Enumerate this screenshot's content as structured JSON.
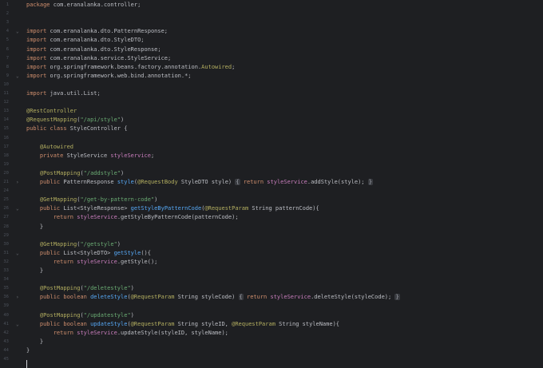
{
  "editor": {
    "lines": [
      {
        "n": "1",
        "fold": "",
        "tokens": [
          {
            "t": "k",
            "v": "package"
          },
          {
            "t": "p",
            "v": " com.eranalanka.controller;"
          }
        ]
      },
      {
        "n": "2",
        "fold": "",
        "tokens": []
      },
      {
        "n": "3",
        "fold": "",
        "tokens": []
      },
      {
        "n": "4",
        "fold": "⌄",
        "tokens": [
          {
            "t": "k",
            "v": "import"
          },
          {
            "t": "p",
            "v": " com.eranalanka.dto.PatternResponse;"
          }
        ]
      },
      {
        "n": "5",
        "fold": "",
        "tokens": [
          {
            "t": "k",
            "v": "import"
          },
          {
            "t": "p",
            "v": " com.eranalanka.dto.StyleDTO;"
          }
        ]
      },
      {
        "n": "6",
        "fold": "",
        "tokens": [
          {
            "t": "k",
            "v": "import"
          },
          {
            "t": "p",
            "v": " com.eranalanka.dto.StyleResponse;"
          }
        ]
      },
      {
        "n": "7",
        "fold": "",
        "tokens": [
          {
            "t": "k",
            "v": "import"
          },
          {
            "t": "p",
            "v": " com.eranalanka.service.StyleService;"
          }
        ]
      },
      {
        "n": "8",
        "fold": "",
        "tokens": [
          {
            "t": "k",
            "v": "import"
          },
          {
            "t": "p",
            "v": " org.springframework.beans.factory.annotation."
          },
          {
            "t": "a",
            "v": "Autowired"
          },
          {
            "t": "p",
            "v": ";"
          }
        ]
      },
      {
        "n": "9",
        "fold": "⌄",
        "tokens": [
          {
            "t": "k",
            "v": "import"
          },
          {
            "t": "p",
            "v": " org.springframework.web.bind.annotation.*;"
          }
        ]
      },
      {
        "n": "10",
        "fold": "",
        "tokens": []
      },
      {
        "n": "11",
        "fold": "",
        "tokens": [
          {
            "t": "k",
            "v": "import"
          },
          {
            "t": "p",
            "v": " java.util.List;"
          }
        ]
      },
      {
        "n": "12",
        "fold": "",
        "tokens": []
      },
      {
        "n": "13",
        "fold": "",
        "tokens": [
          {
            "t": "a",
            "v": "@RestController"
          }
        ]
      },
      {
        "n": "14",
        "fold": "",
        "tokens": [
          {
            "t": "a",
            "v": "@RequestMapping"
          },
          {
            "t": "p",
            "v": "("
          },
          {
            "t": "s",
            "v": "\"/api/style\""
          },
          {
            "t": "p",
            "v": ")"
          }
        ]
      },
      {
        "n": "15",
        "fold": "",
        "tokens": [
          {
            "t": "k",
            "v": "public class"
          },
          {
            "t": "p",
            "v": " StyleController {"
          }
        ]
      },
      {
        "n": "16",
        "fold": "",
        "tokens": []
      },
      {
        "n": "17",
        "fold": "",
        "tokens": [
          {
            "t": "p",
            "v": "    "
          },
          {
            "t": "a",
            "v": "@Autowired"
          }
        ]
      },
      {
        "n": "18",
        "fold": "",
        "tokens": [
          {
            "t": "p",
            "v": "    "
          },
          {
            "t": "k",
            "v": "private"
          },
          {
            "t": "p",
            "v": " StyleService "
          },
          {
            "t": "fi",
            "v": "styleService"
          },
          {
            "t": "p",
            "v": ";"
          }
        ]
      },
      {
        "n": "19",
        "fold": "",
        "tokens": []
      },
      {
        "n": "20",
        "fold": "",
        "tokens": [
          {
            "t": "p",
            "v": "    "
          },
          {
            "t": "a",
            "v": "@PostMapping"
          },
          {
            "t": "p",
            "v": "("
          },
          {
            "t": "s",
            "v": "\"/addstyle\""
          },
          {
            "t": "p",
            "v": ")"
          }
        ]
      },
      {
        "n": "21",
        "fold": "›",
        "tokens": [
          {
            "t": "p",
            "v": "    "
          },
          {
            "t": "k",
            "v": "public"
          },
          {
            "t": "p",
            "v": " PatternResponse "
          },
          {
            "t": "f",
            "v": "style"
          },
          {
            "t": "p",
            "v": "("
          },
          {
            "t": "a",
            "v": "@RequestBody"
          },
          {
            "t": "p",
            "v": " StyleDTO style) "
          },
          {
            "t": "c",
            "v": "{"
          },
          {
            "t": "p",
            "v": " "
          },
          {
            "t": "k",
            "v": "return"
          },
          {
            "t": "p",
            "v": " "
          },
          {
            "t": "fi",
            "v": "styleService"
          },
          {
            "t": "p",
            "v": ".addStyle(style); "
          },
          {
            "t": "c",
            "v": "}"
          }
        ]
      },
      {
        "n": "24",
        "fold": "",
        "tokens": []
      },
      {
        "n": "25",
        "fold": "",
        "tokens": [
          {
            "t": "p",
            "v": "    "
          },
          {
            "t": "a",
            "v": "@GetMapping"
          },
          {
            "t": "p",
            "v": "("
          },
          {
            "t": "s",
            "v": "\"/get-by-pattern-code\""
          },
          {
            "t": "p",
            "v": ")"
          }
        ]
      },
      {
        "n": "26",
        "fold": "⌄",
        "tokens": [
          {
            "t": "p",
            "v": "    "
          },
          {
            "t": "k",
            "v": "public"
          },
          {
            "t": "p",
            "v": " List<StyleResponse> "
          },
          {
            "t": "f",
            "v": "getStyleByPatternCode"
          },
          {
            "t": "p",
            "v": "("
          },
          {
            "t": "a",
            "v": "@RequestParam"
          },
          {
            "t": "p",
            "v": " String patternCode){"
          }
        ]
      },
      {
        "n": "27",
        "fold": "",
        "tokens": [
          {
            "t": "p",
            "v": "        "
          },
          {
            "t": "k",
            "v": "return"
          },
          {
            "t": "p",
            "v": " "
          },
          {
            "t": "fi",
            "v": "styleService"
          },
          {
            "t": "p",
            "v": ".getStyleByPatternCode(patternCode);"
          }
        ]
      },
      {
        "n": "28",
        "fold": "",
        "tokens": [
          {
            "t": "p",
            "v": "    }"
          }
        ]
      },
      {
        "n": "29",
        "fold": "",
        "tokens": []
      },
      {
        "n": "30",
        "fold": "",
        "tokens": [
          {
            "t": "p",
            "v": "    "
          },
          {
            "t": "a",
            "v": "@GetMapping"
          },
          {
            "t": "p",
            "v": "("
          },
          {
            "t": "s",
            "v": "\"/getstyle\""
          },
          {
            "t": "p",
            "v": ")"
          }
        ]
      },
      {
        "n": "31",
        "fold": "⌄",
        "tokens": [
          {
            "t": "p",
            "v": "    "
          },
          {
            "t": "k",
            "v": "public"
          },
          {
            "t": "p",
            "v": " List<StyleDTO> "
          },
          {
            "t": "f",
            "v": "getStyle"
          },
          {
            "t": "p",
            "v": "(){"
          }
        ]
      },
      {
        "n": "32",
        "fold": "",
        "tokens": [
          {
            "t": "p",
            "v": "        "
          },
          {
            "t": "k",
            "v": "return"
          },
          {
            "t": "p",
            "v": " "
          },
          {
            "t": "fi",
            "v": "styleService"
          },
          {
            "t": "p",
            "v": ".getStyle();"
          }
        ]
      },
      {
        "n": "33",
        "fold": "",
        "tokens": [
          {
            "t": "p",
            "v": "    }"
          }
        ]
      },
      {
        "n": "34",
        "fold": "",
        "tokens": []
      },
      {
        "n": "35",
        "fold": "",
        "tokens": [
          {
            "t": "p",
            "v": "    "
          },
          {
            "t": "a",
            "v": "@PostMapping"
          },
          {
            "t": "p",
            "v": "("
          },
          {
            "t": "s",
            "v": "\"/deletestyle\""
          },
          {
            "t": "p",
            "v": ")"
          }
        ]
      },
      {
        "n": "36",
        "fold": "›",
        "tokens": [
          {
            "t": "p",
            "v": "    "
          },
          {
            "t": "k",
            "v": "public boolean"
          },
          {
            "t": "p",
            "v": " "
          },
          {
            "t": "f",
            "v": "deleteStyle"
          },
          {
            "t": "p",
            "v": "("
          },
          {
            "t": "a",
            "v": "@RequestParam"
          },
          {
            "t": "p",
            "v": " String styleCode) "
          },
          {
            "t": "c",
            "v": "{"
          },
          {
            "t": "p",
            "v": " "
          },
          {
            "t": "k",
            "v": "return"
          },
          {
            "t": "p",
            "v": " "
          },
          {
            "t": "fi",
            "v": "styleService"
          },
          {
            "t": "p",
            "v": ".deleteStyle(styleCode); "
          },
          {
            "t": "c",
            "v": "}"
          }
        ]
      },
      {
        "n": "39",
        "fold": "",
        "tokens": []
      },
      {
        "n": "40",
        "fold": "",
        "tokens": [
          {
            "t": "p",
            "v": "    "
          },
          {
            "t": "a",
            "v": "@PostMapping"
          },
          {
            "t": "p",
            "v": "("
          },
          {
            "t": "s",
            "v": "\"/updatestyle\""
          },
          {
            "t": "p",
            "v": ")"
          }
        ]
      },
      {
        "n": "41",
        "fold": "⌄",
        "tokens": [
          {
            "t": "p",
            "v": "    "
          },
          {
            "t": "k",
            "v": "public boolean"
          },
          {
            "t": "p",
            "v": " "
          },
          {
            "t": "f",
            "v": "updateStyle"
          },
          {
            "t": "p",
            "v": "("
          },
          {
            "t": "a",
            "v": "@RequestParam"
          },
          {
            "t": "p",
            "v": " String styleID, "
          },
          {
            "t": "a",
            "v": "@RequestParam"
          },
          {
            "t": "p",
            "v": " String styleName){"
          }
        ]
      },
      {
        "n": "42",
        "fold": "",
        "tokens": [
          {
            "t": "p",
            "v": "        "
          },
          {
            "t": "k",
            "v": "return"
          },
          {
            "t": "p",
            "v": " "
          },
          {
            "t": "fi",
            "v": "styleService"
          },
          {
            "t": "p",
            "v": ".updateStyle(styleID, styleName);"
          }
        ]
      },
      {
        "n": "43",
        "fold": "",
        "tokens": [
          {
            "t": "p",
            "v": "    }"
          }
        ]
      },
      {
        "n": "44",
        "fold": "",
        "tokens": [
          {
            "t": "p",
            "v": "}"
          }
        ]
      },
      {
        "n": "45",
        "fold": "",
        "tokens": []
      }
    ]
  }
}
